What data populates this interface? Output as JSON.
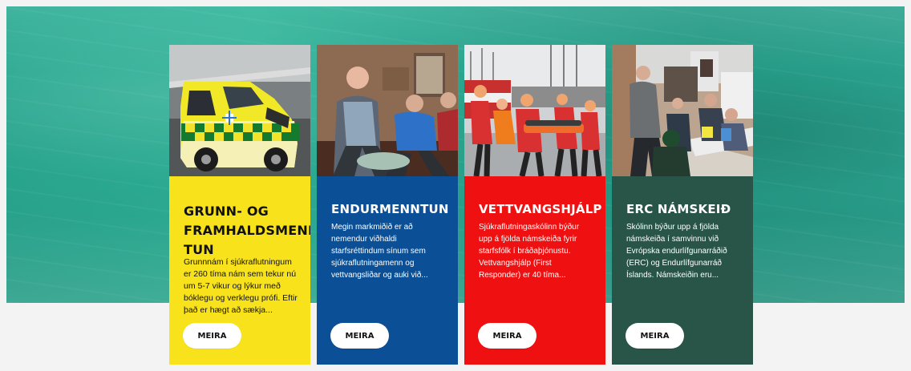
{
  "cards": [
    {
      "title": "GRUNN- OG FRAMHALDSMENN TUN",
      "description": "Grunnnám í sjúkraflutningum er 260 tíma nám sem tekur nú um 5-7 vikur og lýkur með bóklegu og verklegu prófi. Eftir það er hægt að sækja...",
      "button": "MEIRA",
      "photo_icon": "ambulance-photo"
    },
    {
      "title": "ENDURMENNTUN",
      "description": "Megin markmiðið er að nemendur viðhaldi starfsréttindum sínum sem sjúkraflutningamenn og vettvangsliðar og auki við...",
      "button": "MEIRA",
      "photo_icon": "training-photo"
    },
    {
      "title": "VETTVANGSHJÁLP",
      "description": "Sjúkraflutningaskólinn býður upp á fjölda námskeiða fyrir starfsfólk í bráðaþjónustu. Vettvangshjálp (First Responder) er 40 tíma...",
      "button": "MEIRA",
      "photo_icon": "rescue-photo"
    },
    {
      "title": "ERC NÁMSKEIÐ",
      "description": "Skólinn býður upp á fjölda námskeiða í samvinnu við Evrópska endurlífgunarráðið (ERC) og Endurlífgunarráð Íslands. Námskeiðin eru...",
      "button": "MEIRA",
      "photo_icon": "classroom-photo"
    }
  ],
  "colors": {
    "yellow": "#f8e21c",
    "blue": "#0b4f96",
    "red": "#ef1111",
    "green": "#285547",
    "hero": "#2aa58f"
  }
}
